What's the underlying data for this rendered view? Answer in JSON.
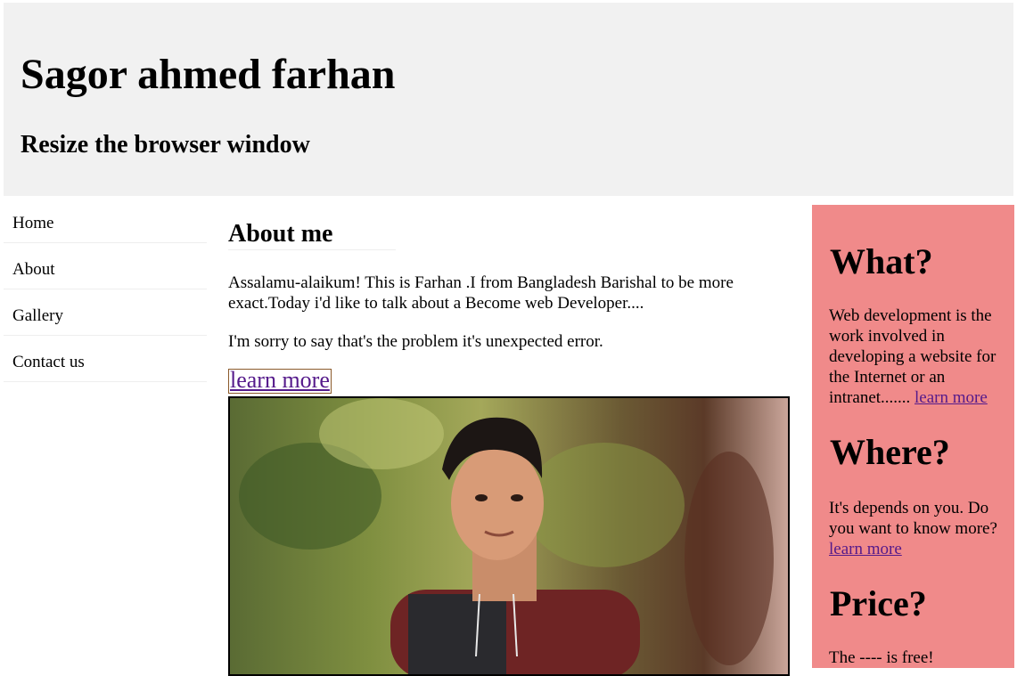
{
  "header": {
    "title": "Sagor ahmed farhan",
    "subtitle": "Resize the browser window"
  },
  "nav": {
    "items": [
      {
        "label": "Home"
      },
      {
        "label": "About"
      },
      {
        "label": "Gallery"
      },
      {
        "label": "Contact us"
      }
    ]
  },
  "main": {
    "heading": "About me",
    "paragraph1": "Assalamu-alaikum! This is Farhan .I from Bangladesh Barishal to be more exact.Today i'd like to talk about a Become web Developer....",
    "paragraph2": "I'm sorry to say that's the problem it's unexpected error.",
    "learn_more_label": "learn more"
  },
  "aside": {
    "sections": [
      {
        "heading": "What?",
        "text": "Web development is the work involved in developing a website for the Internet or an intranet.......",
        "link": "learn more"
      },
      {
        "heading": "Where?",
        "text": "It's depends on you. Do you want to know more?",
        "link": "learn more"
      },
      {
        "heading": "Price?",
        "text": "The ---- is free!"
      }
    ]
  },
  "colors": {
    "header_bg": "#f1f1f1",
    "aside_bg": "#f08a8a",
    "link": "#551a8b"
  }
}
